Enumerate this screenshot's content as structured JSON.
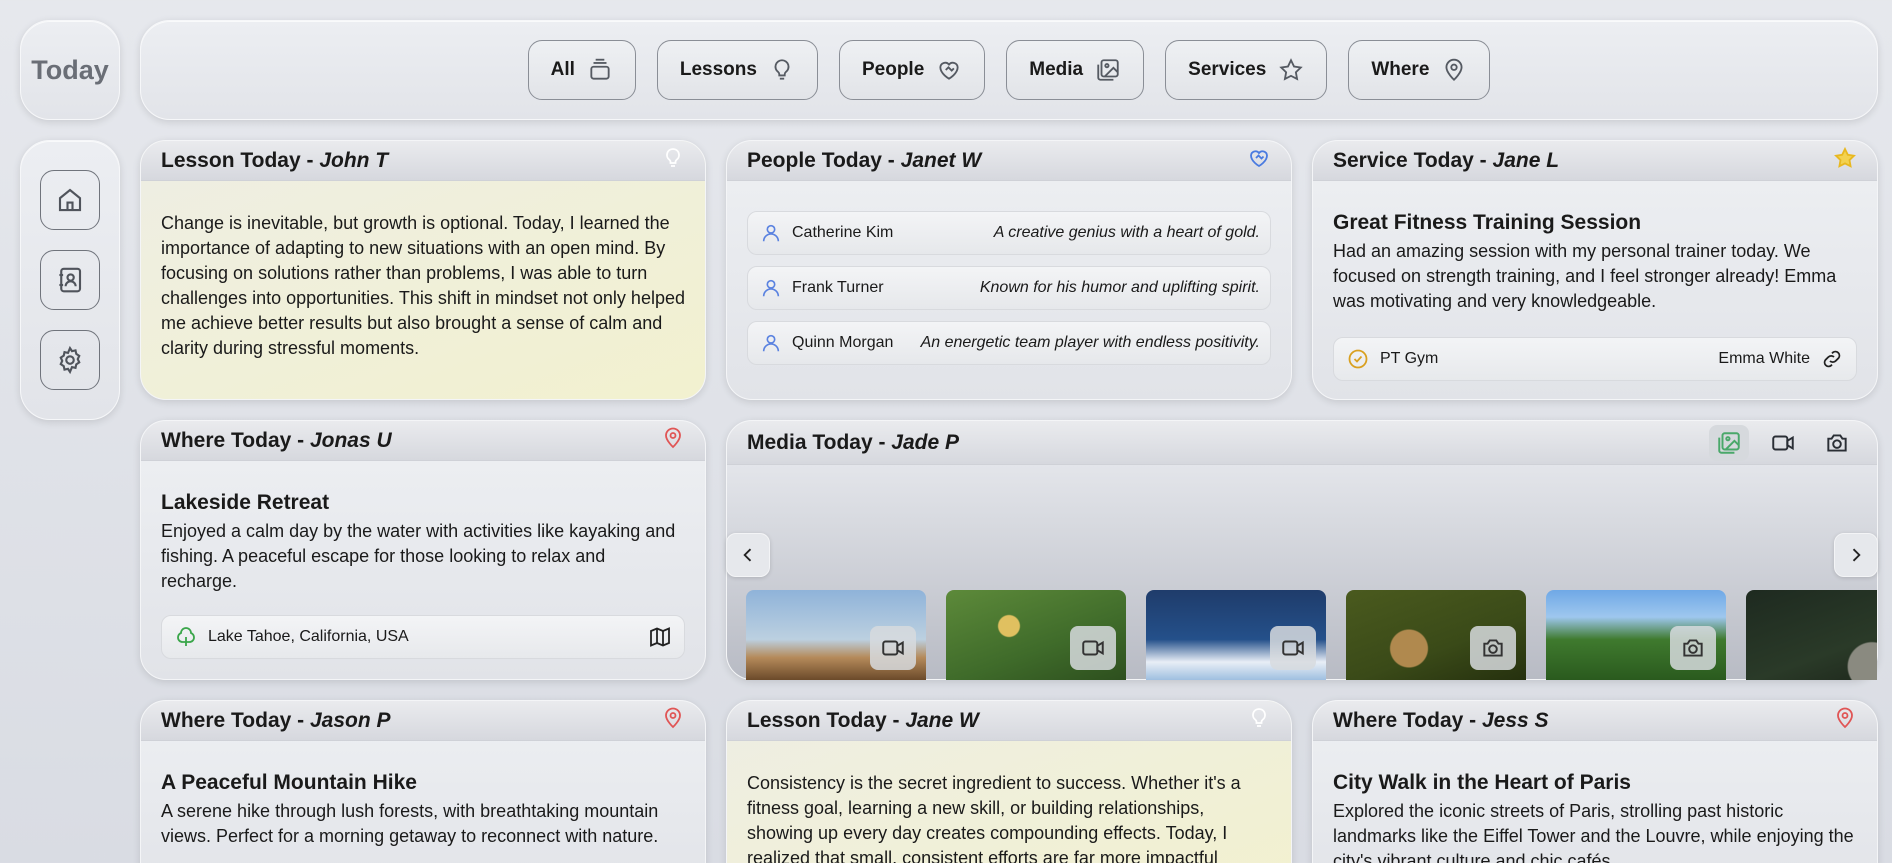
{
  "app": {
    "title": "Today"
  },
  "filters": [
    {
      "label": "All",
      "icon": "stack-icon"
    },
    {
      "label": "Lessons",
      "icon": "lightbulb-icon"
    },
    {
      "label": "People",
      "icon": "heart-handshake-icon"
    },
    {
      "label": "Media",
      "icon": "image-gallery-icon"
    },
    {
      "label": "Services",
      "icon": "star-icon"
    },
    {
      "label": "Where",
      "icon": "map-pin-icon"
    }
  ],
  "nav": [
    {
      "name": "home",
      "icon": "home-icon"
    },
    {
      "name": "contacts",
      "icon": "contact-book-icon"
    },
    {
      "name": "settings",
      "icon": "gear-icon"
    }
  ],
  "colors": {
    "pin": "#e05555",
    "star": "#e8b820",
    "heart": "#4a7be0",
    "tree": "#3aa64a",
    "lesson_bulb": "#ffffff",
    "media_active": "#4aa86a"
  },
  "lesson1": {
    "label": "Lesson Today - ",
    "author": "John T",
    "text": "Change is inevitable, but growth is optional. Today, I learned the importance of adapting to new situations with an open mind. By focusing on solutions rather than problems, I was able to turn challenges into opportunities. This shift in mindset not only helped me achieve better results but also brought a sense of calm and clarity during stressful moments."
  },
  "people1": {
    "label": "People Today - ",
    "author": "Janet W",
    "people": [
      {
        "name": "Catherine Kim",
        "desc": "A creative genius with a heart of gold."
      },
      {
        "name": "Frank Turner",
        "desc": "Known for his humor and uplifting spirit."
      },
      {
        "name": "Quinn Morgan",
        "desc": "An energetic team player with endless positivity."
      }
    ]
  },
  "service1": {
    "label": "Service Today - ",
    "author": "Jane L",
    "title": "Great Fitness Training Session",
    "text": "Had an amazing session with my personal trainer today. We focused on strength training, and I feel stronger already! Emma was motivating and very knowledgeable.",
    "place": "PT Gym",
    "provider": "Emma White"
  },
  "where1": {
    "label": "Where Today - ",
    "author": "Jonas U",
    "title": "Lakeside Retreat",
    "text": "Enjoyed a calm day by the water with activities like kayaking and fishing. A peaceful escape for those looking to relax and recharge.",
    "location": "Lake Tahoe, California, USA"
  },
  "media1": {
    "label": "Media Today - ",
    "author": "Jade P",
    "thumbs": [
      {
        "kind": "video",
        "badge": "video-camera-icon"
      },
      {
        "kind": "video",
        "badge": "video-camera-icon"
      },
      {
        "kind": "video",
        "badge": "video-camera-icon"
      },
      {
        "kind": "photo",
        "badge": "camera-icon"
      },
      {
        "kind": "photo",
        "badge": "camera-icon"
      },
      {
        "kind": "photo",
        "badge": "camera-icon"
      }
    ]
  },
  "where2": {
    "label": "Where Today - ",
    "author": "Jason P",
    "title": "A Peaceful Mountain Hike",
    "text": "A serene hike through lush forests, with breathtaking mountain views. Perfect for a morning getaway to reconnect with nature."
  },
  "lesson2": {
    "label": "Lesson Today - ",
    "author": "Jane W",
    "text": "Consistency is the secret ingredient to success. Whether it's a fitness goal, learning a new skill, or building relationships, showing up every day creates compounding effects. Today, I realized that small, consistent efforts are far more impactful"
  },
  "where3": {
    "label": "Where Today - ",
    "author": "Jess S",
    "title": "City Walk in the Heart of Paris",
    "text": "Explored the iconic streets of Paris, strolling past historic landmarks like the Eiffel Tower and the Louvre, while enjoying the city's vibrant culture and chic cafés."
  }
}
